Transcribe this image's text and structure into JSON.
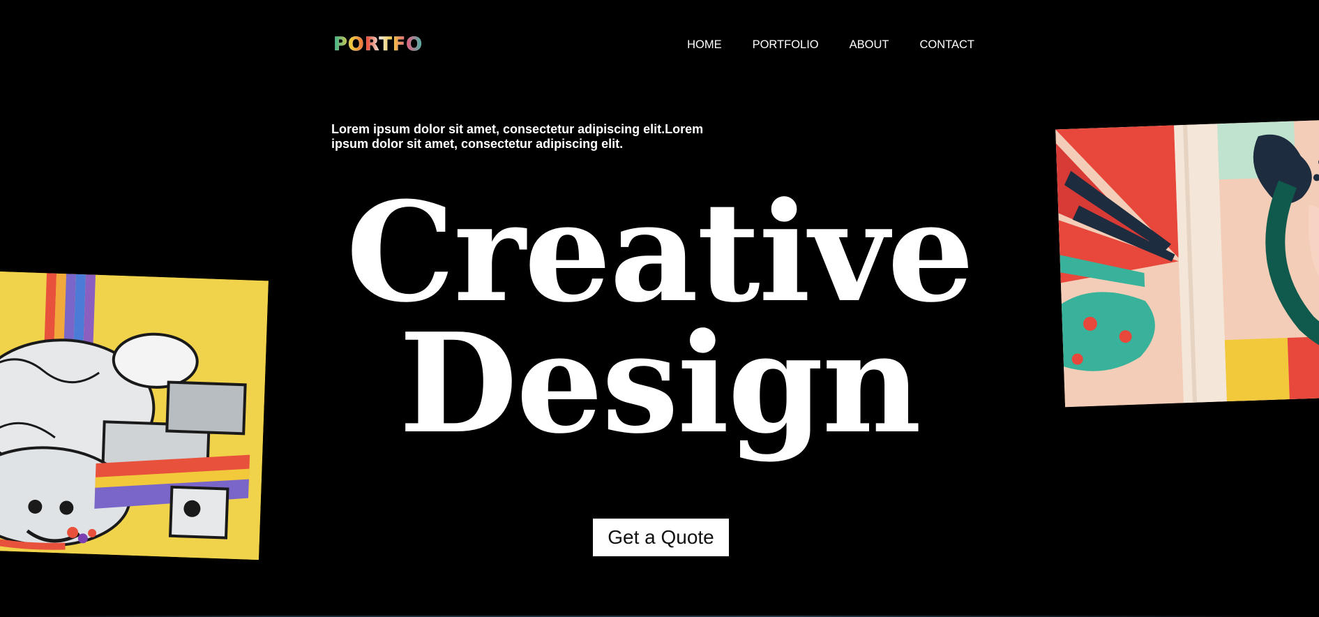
{
  "header": {
    "logo": "PORTFO",
    "nav": [
      {
        "label": "HOME"
      },
      {
        "label": "PORTFOLIO"
      },
      {
        "label": "ABOUT"
      },
      {
        "label": "CONTACT"
      }
    ]
  },
  "hero": {
    "intro": "Lorem ipsum dolor sit amet, consectetur adipiscing elit.Lorem ipsum dolor sit amet, consectetur adipiscing elit.",
    "title_line1": "Creative",
    "title_line2": "Design",
    "cta_label": "Get a Quote"
  },
  "artworks": [
    {
      "subject": "yellow-doodle-mural"
    },
    {
      "subject": "abstract-colorful-mural"
    }
  ],
  "colors": {
    "background": "#000000",
    "text": "#ffffff",
    "cta_background": "#ffffff",
    "cta_text": "#111111"
  }
}
